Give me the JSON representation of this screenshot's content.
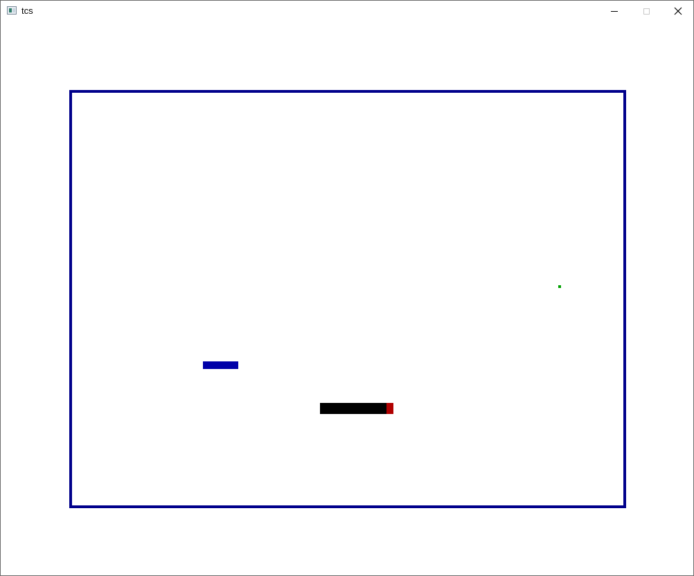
{
  "window": {
    "title": "tcs",
    "app_icon": "window-app-icon",
    "controls": [
      "minimize-icon",
      "maximize-icon",
      "close-icon"
    ]
  },
  "game": {
    "colors": {
      "border": "#00008b",
      "background": "#ffffff",
      "food": "#00a000",
      "obstacle": "#0000a8",
      "snake_body": "#000000",
      "snake_head": "#b00000"
    },
    "snake": {
      "head_direction": "right"
    }
  }
}
